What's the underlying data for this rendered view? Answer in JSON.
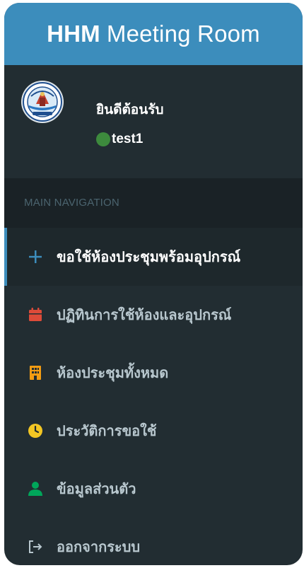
{
  "app": {
    "title_bold": "HHM",
    "title_rest": "Meeting Room"
  },
  "user": {
    "welcome": "ยินดีต้อนรับ",
    "name": "test1",
    "status_color": "#3d8a3d"
  },
  "nav": {
    "header": "MAIN NAVIGATION",
    "items": [
      {
        "label": "ขอใช้ห้องประชุมพร้อมอุปกรณ์",
        "icon": "plus-icon",
        "active": true
      },
      {
        "label": "ปฏิทินการใช้ห้องและอุปกรณ์",
        "icon": "calendar-icon",
        "active": false
      },
      {
        "label": "ห้องประชุมทั้งหมด",
        "icon": "building-icon",
        "active": false
      },
      {
        "label": "ประวัติการขอใช้",
        "icon": "clock-icon",
        "active": false
      },
      {
        "label": "ข้อมูลส่วนตัว",
        "icon": "user-icon",
        "active": false
      },
      {
        "label": "ออกจากระบบ",
        "icon": "logout-icon",
        "active": false
      }
    ]
  },
  "colors": {
    "header_bg": "#3c8dbc",
    "sidebar_bg": "#222d32",
    "nav_header_bg": "#1a2226",
    "active_bg": "#1e282c",
    "accent": "#3c8dbc"
  }
}
